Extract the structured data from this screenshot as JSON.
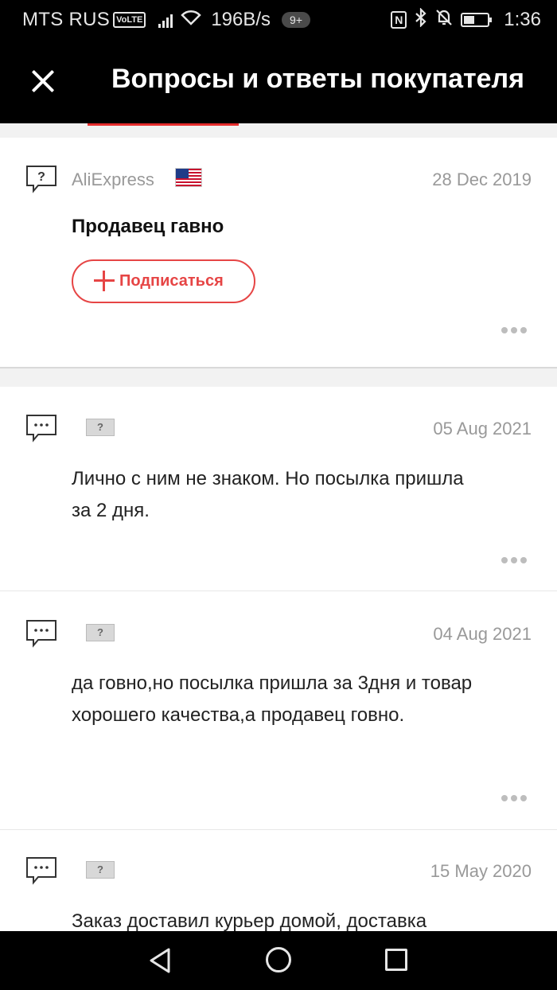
{
  "status_bar": {
    "carrier": "MTS RUS",
    "volte": "VoLTE",
    "speed": "196B/s",
    "notification_count": "9+",
    "nfc": "N",
    "time": "1:36"
  },
  "header": {
    "title": "Вопросы и ответы покупателя"
  },
  "question": {
    "author": "AliExpress",
    "date": "28 Dec 2019",
    "text": "Продавец гавно",
    "subscribe_label": "Подписаться"
  },
  "answers": [
    {
      "date": "05 Aug 2021",
      "text": "Лично с ним не знаком. Но посылка пришла за 2 дня.",
      "flag": "?"
    },
    {
      "date": "04 Aug 2021",
      "text": "да говно,но посылка пришла за 3дня и товар хорошего качества,а продавец говно.",
      "flag": "?"
    },
    {
      "date": "15 May 2020",
      "text": "Заказ доставил курьер домой, доставка",
      "flag": "?"
    }
  ],
  "colors": {
    "accent": "#e64545",
    "background": "#f2f2f2"
  }
}
